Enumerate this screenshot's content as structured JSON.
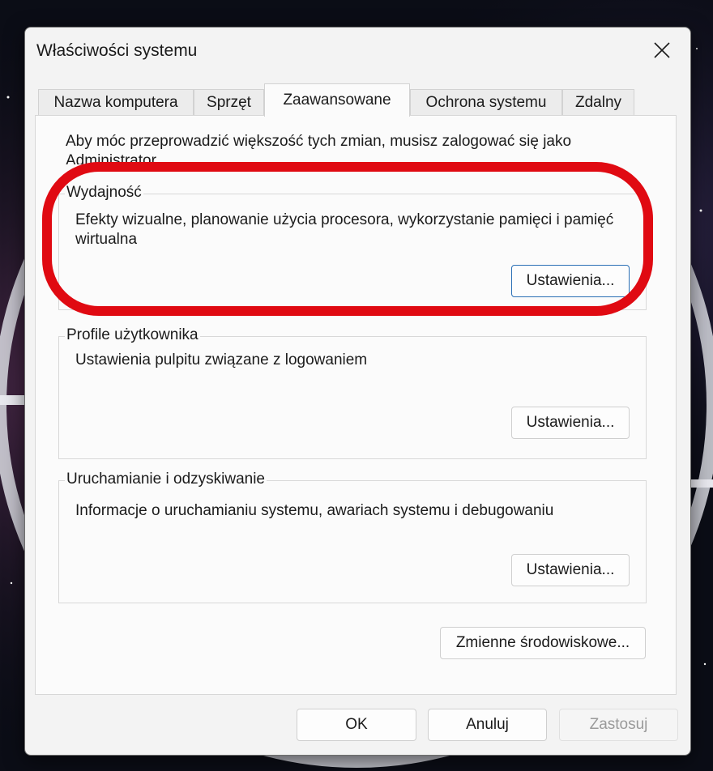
{
  "window": {
    "title": "Właściwości systemu"
  },
  "tabs": [
    {
      "label": "Nazwa komputera",
      "active": false
    },
    {
      "label": "Sprzęt",
      "active": false
    },
    {
      "label": "Zaawansowane",
      "active": true
    },
    {
      "label": "Ochrona systemu",
      "active": false
    },
    {
      "label": "Zdalny",
      "active": false
    }
  ],
  "admin_note": "Aby móc przeprowadzić większość tych zmian, musisz zalogować się jako Administrator.",
  "groups": {
    "performance": {
      "title": "Wydajność",
      "description": "Efekty wizualne, planowanie użycia procesora, wykorzystanie pamięci i pamięć wirtualna",
      "button": "Ustawienia..."
    },
    "profiles": {
      "title": "Profile użytkownika",
      "description": "Ustawienia pulpitu związane z logowaniem",
      "button": "Ustawienia..."
    },
    "startup": {
      "title": "Uruchamianie i odzyskiwanie",
      "description": "Informacje o uruchamianiu systemu, awariach systemu i debugowaniu",
      "button": "Ustawienia..."
    }
  },
  "env_button": "Zmienne środowiskowe...",
  "footer": {
    "ok": "OK",
    "cancel": "Anuluj",
    "apply": "Zastosuj"
  },
  "colors": {
    "annotation": "#e00a12",
    "focus": "#2a6fb5"
  }
}
